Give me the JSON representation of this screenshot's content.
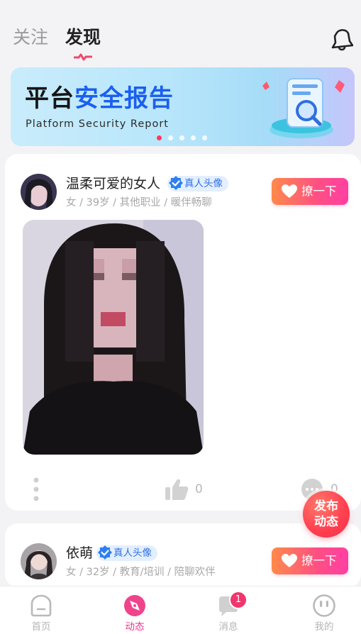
{
  "top_tabs": {
    "follow": "关注",
    "discover": "发现"
  },
  "banner": {
    "title_part1": "平台",
    "title_part2": "安全报告",
    "subtitle": "Platform Security Report",
    "page_count": 5,
    "active_page": 1
  },
  "posts": [
    {
      "name": "温柔可爱的女人",
      "verified_label": "真人头像",
      "meta": "女 / 39岁 / 其他职业 / 暖伴畅聊",
      "flirt_label": "撩一下",
      "like_count": "0",
      "comment_count": "0"
    },
    {
      "name": "依萌",
      "verified_label": "真人头像",
      "meta": "女 / 32岁 / 教育/培训 / 陪聊欢伴",
      "flirt_label": "撩一下"
    }
  ],
  "fab": {
    "line1": "发布",
    "line2": "动态"
  },
  "bottom_nav": {
    "items": [
      {
        "label": "首页",
        "icon": "home-icon"
      },
      {
        "label": "动态",
        "icon": "compass-icon"
      },
      {
        "label": "消息",
        "icon": "message-icon",
        "badge": "1"
      },
      {
        "label": "我的",
        "icon": "profile-icon"
      }
    ],
    "active_index": 1
  },
  "colors": {
    "accent_pink": "#e8368f",
    "verified_blue": "#2e71e6",
    "flirt_gradient_start": "#ff8a4a",
    "flirt_gradient_end": "#ff3fa3",
    "fab_red": "#ff3e4f"
  }
}
